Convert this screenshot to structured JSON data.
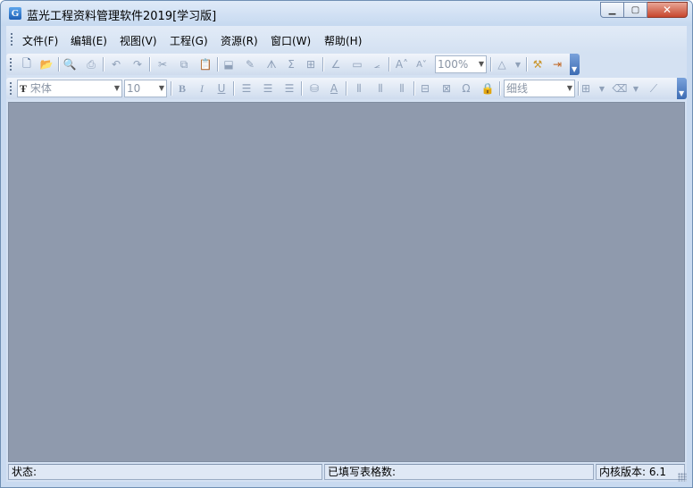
{
  "window": {
    "title": "蓝光工程资料管理软件2019[学习版]"
  },
  "menu": [
    {
      "label": "文件(F)"
    },
    {
      "label": "编辑(E)"
    },
    {
      "label": "视图(V)"
    },
    {
      "label": "工程(G)"
    },
    {
      "label": "资源(R)"
    },
    {
      "label": "窗口(W)"
    },
    {
      "label": "帮助(H)"
    }
  ],
  "toolbar1": {
    "zoom": "100%"
  },
  "toolbar2": {
    "font": "宋体",
    "size": "10",
    "line_style": "细线"
  },
  "status": {
    "state_label": "状态:",
    "filled_label": "已填写表格数:",
    "kernel_label": "内核版本:",
    "kernel_version": "6.1"
  },
  "colors": {
    "workspace": "#8f9aad",
    "frame": "#d4e1f2",
    "close_button": "#c7462c"
  }
}
